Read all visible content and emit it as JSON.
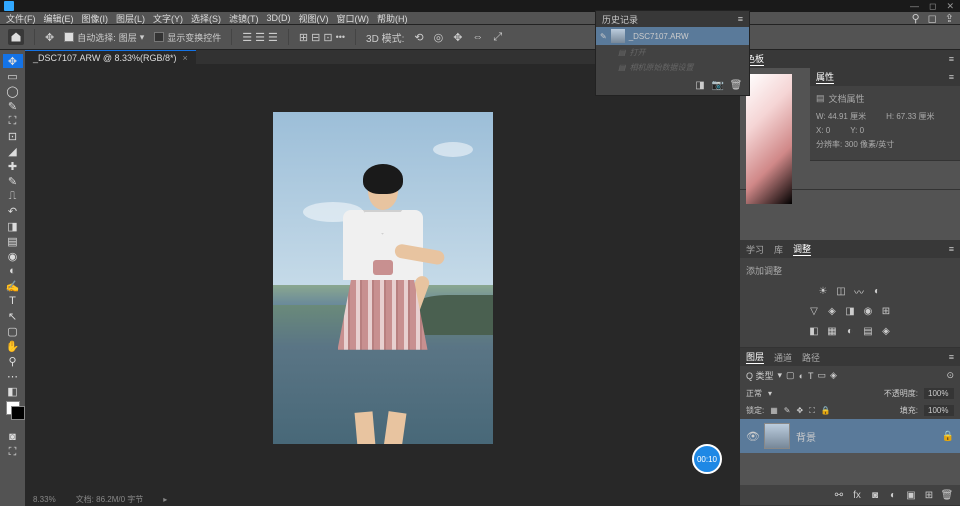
{
  "titlebar": {
    "appname": "Ps"
  },
  "menubar": [
    "文件(F)",
    "编辑(E)",
    "图像(I)",
    "图层(L)",
    "文字(Y)",
    "选择(S)",
    "滤镜(T)",
    "3D(D)",
    "视图(V)",
    "窗口(W)",
    "帮助(H)"
  ],
  "optionbar": {
    "autoselect_label": "自动选择:",
    "autoselect_value": "图层",
    "transform_label": "显示变换控件",
    "mode_label": "3D 模式:"
  },
  "tab": {
    "name": "_DSC7107.ARW @ 8.33%(RGB/8*)",
    "close": "×"
  },
  "history": {
    "title": "历史记录",
    "items": [
      {
        "label": "_DSC7107.ARW",
        "sel": true
      },
      {
        "label": "打开",
        "dim": true
      },
      {
        "label": "相机原始数据设置",
        "dim": true
      }
    ]
  },
  "panels": {
    "color": {
      "tab": "色板"
    },
    "properties": {
      "tab": "属性",
      "doc_label": "文档属性",
      "w": "W: 44.91 厘米",
      "h": "H: 67.33 厘米",
      "x": "X: 0",
      "y": "Y: 0",
      "res": "分辨率: 300 像素/英寸"
    },
    "adjust": {
      "tabs": [
        "学习",
        "库",
        "调整"
      ],
      "preset": "添加调整"
    },
    "layers": {
      "tabs": [
        "图层",
        "通道",
        "路径"
      ],
      "filter": "Q 类型",
      "mode_label": "正常",
      "opacity_label": "不透明度:",
      "opacity": "100%",
      "lock_label": "锁定:",
      "fill_label": "填充:",
      "fill": "100%",
      "bg": "背景"
    }
  },
  "status": {
    "zoom": "8.33%",
    "size": "文档: 86.2M/0 字节"
  },
  "timer": "00:10"
}
